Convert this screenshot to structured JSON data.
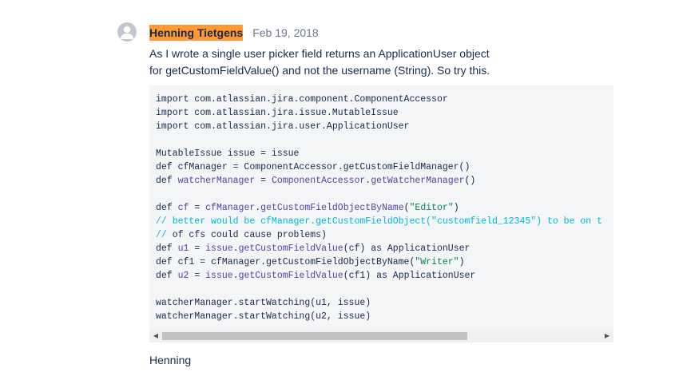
{
  "comment": {
    "author": "Henning Tietgens",
    "date": "Feb 19, 2018",
    "body_lines": [
      "As I wrote a single user picker field returns an ApplicationUser object",
      "for getCustomFieldValue() and not the username (String). So try this."
    ],
    "signature": "Henning"
  },
  "code": {
    "lines": [
      [
        {
          "t": "import com.atlassian.jira.component.ComponentAccessor",
          "c": "k"
        }
      ],
      [
        {
          "t": "import com.atlassian.jira.issue.MutableIssue",
          "c": "k"
        }
      ],
      [
        {
          "t": "import com.atlassian.jira.user.ApplicationUser",
          "c": "k"
        }
      ],
      [],
      [
        {
          "t": "MutableIssue issue = issue",
          "c": "k"
        }
      ],
      [
        {
          "t": "def cfManager = ComponentAccessor.getCustomFieldManager()",
          "c": "k"
        }
      ],
      [
        {
          "t": "def ",
          "c": "k"
        },
        {
          "t": "watcherManager",
          "c": "v"
        },
        {
          "t": " = ",
          "c": "k"
        },
        {
          "t": "ComponentAccessor",
          "c": "v"
        },
        {
          "t": ".",
          "c": "k"
        },
        {
          "t": "getWatcherManager",
          "c": "v"
        },
        {
          "t": "()",
          "c": "k"
        }
      ],
      [],
      [
        {
          "t": "def ",
          "c": "k"
        },
        {
          "t": "cf",
          "c": "v"
        },
        {
          "t": " = ",
          "c": "k"
        },
        {
          "t": "cfManager",
          "c": "v"
        },
        {
          "t": ".",
          "c": "k"
        },
        {
          "t": "getCustomFieldObjectByName",
          "c": "v"
        },
        {
          "t": "(",
          "c": "k"
        },
        {
          "t": "\"Editor\"",
          "c": "s"
        },
        {
          "t": ")",
          "c": "k"
        }
      ],
      [
        {
          "t": "// better would be cfManager.getCustomFieldObject(\"customfield_12345\") to be on t",
          "c": "c"
        }
      ],
      [
        {
          "t": "// ",
          "c": "c"
        },
        {
          "t": "of cfs could cause problems)",
          "c": "k"
        }
      ],
      [
        {
          "t": "def ",
          "c": "k"
        },
        {
          "t": "u1",
          "c": "v"
        },
        {
          "t": " = ",
          "c": "k"
        },
        {
          "t": "issue",
          "c": "v"
        },
        {
          "t": ".",
          "c": "k"
        },
        {
          "t": "getCustomFieldValue",
          "c": "v"
        },
        {
          "t": "(cf) as ApplicationUser",
          "c": "k"
        }
      ],
      [
        {
          "t": "def cf1 = cfManager.getCustomFieldObjectByName(",
          "c": "k"
        },
        {
          "t": "\"Writer\"",
          "c": "s"
        },
        {
          "t": ")",
          "c": "k"
        }
      ],
      [
        {
          "t": "def ",
          "c": "k"
        },
        {
          "t": "u2",
          "c": "v"
        },
        {
          "t": " = ",
          "c": "k"
        },
        {
          "t": "issue",
          "c": "v"
        },
        {
          "t": ".",
          "c": "k"
        },
        {
          "t": "getCustomFieldValue",
          "c": "v"
        },
        {
          "t": "(cf1) as ApplicationUser",
          "c": "k"
        }
      ],
      [],
      [
        {
          "t": "watcherManager.startWatching(u1, issue)",
          "c": "k"
        }
      ],
      [
        {
          "t": "watcherManager.startWatching(u2, issue)",
          "c": "k"
        }
      ]
    ]
  },
  "scrollbar": {
    "left_arrow": "◀",
    "right_arrow": "▶"
  },
  "colors": {
    "author_highlight": "#ff9933",
    "code_background": "#f4f5f7",
    "keyword_purple": "#5243aa",
    "string_green": "#00875a",
    "comment_cyan": "#00b8d9"
  }
}
